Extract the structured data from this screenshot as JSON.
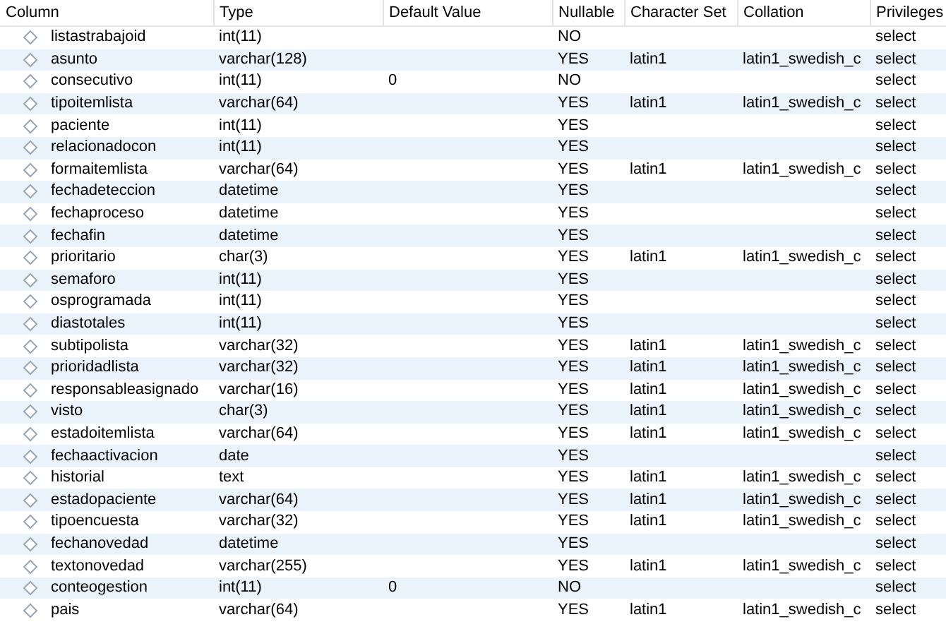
{
  "table": {
    "columns": [
      "Column",
      "Type",
      "Default Value",
      "Nullable",
      "Character Set",
      "Collation",
      "Privileges"
    ],
    "rows": [
      [
        "listastrabajoid",
        "int(11)",
        "",
        "NO",
        "",
        "",
        "select"
      ],
      [
        "asunto",
        "varchar(128)",
        "",
        "YES",
        "latin1",
        "latin1_swedish_c",
        "select"
      ],
      [
        "consecutivo",
        "int(11)",
        "0",
        "NO",
        "",
        "",
        "select"
      ],
      [
        "tipoitemlista",
        "varchar(64)",
        "",
        "YES",
        "latin1",
        "latin1_swedish_c",
        "select"
      ],
      [
        "paciente",
        "int(11)",
        "",
        "YES",
        "",
        "",
        "select"
      ],
      [
        "relacionadocon",
        "int(11)",
        "",
        "YES",
        "",
        "",
        "select"
      ],
      [
        "formaitemlista",
        "varchar(64)",
        "",
        "YES",
        "latin1",
        "latin1_swedish_c",
        "select"
      ],
      [
        "fechadeteccion",
        "datetime",
        "",
        "YES",
        "",
        "",
        "select"
      ],
      [
        "fechaproceso",
        "datetime",
        "",
        "YES",
        "",
        "",
        "select"
      ],
      [
        "fechafin",
        "datetime",
        "",
        "YES",
        "",
        "",
        "select"
      ],
      [
        "prioritario",
        "char(3)",
        "",
        "YES",
        "latin1",
        "latin1_swedish_c",
        "select"
      ],
      [
        "semaforo",
        "int(11)",
        "",
        "YES",
        "",
        "",
        "select"
      ],
      [
        "osprogramada",
        "int(11)",
        "",
        "YES",
        "",
        "",
        "select"
      ],
      [
        "diastotales",
        "int(11)",
        "",
        "YES",
        "",
        "",
        "select"
      ],
      [
        "subtipolista",
        "varchar(32)",
        "",
        "YES",
        "latin1",
        "latin1_swedish_c",
        "select"
      ],
      [
        "prioridadlista",
        "varchar(32)",
        "",
        "YES",
        "latin1",
        "latin1_swedish_c",
        "select"
      ],
      [
        "responsableasignado",
        "varchar(16)",
        "",
        "YES",
        "latin1",
        "latin1_swedish_c",
        "select"
      ],
      [
        "visto",
        "char(3)",
        "",
        "YES",
        "latin1",
        "latin1_swedish_c",
        "select"
      ],
      [
        "estadoitemlista",
        "varchar(64)",
        "",
        "YES",
        "latin1",
        "latin1_swedish_c",
        "select"
      ],
      [
        "fechaactivacion",
        "date",
        "",
        "YES",
        "",
        "",
        "select"
      ],
      [
        "historial",
        "text",
        "",
        "YES",
        "latin1",
        "latin1_swedish_c",
        "select"
      ],
      [
        "estadopaciente",
        "varchar(64)",
        "",
        "YES",
        "latin1",
        "latin1_swedish_c",
        "select"
      ],
      [
        "tipoencuesta",
        "varchar(32)",
        "",
        "YES",
        "latin1",
        "latin1_swedish_c",
        "select"
      ],
      [
        "fechanovedad",
        "datetime",
        "",
        "YES",
        "",
        "",
        "select"
      ],
      [
        "textonovedad",
        "varchar(255)",
        "",
        "YES",
        "latin1",
        "latin1_swedish_c",
        "select"
      ],
      [
        "conteogestion",
        "int(11)",
        "0",
        "NO",
        "",
        "",
        "select"
      ],
      [
        "pais",
        "varchar(64)",
        "",
        "YES",
        "latin1",
        "latin1_swedish_c",
        "select"
      ]
    ]
  }
}
